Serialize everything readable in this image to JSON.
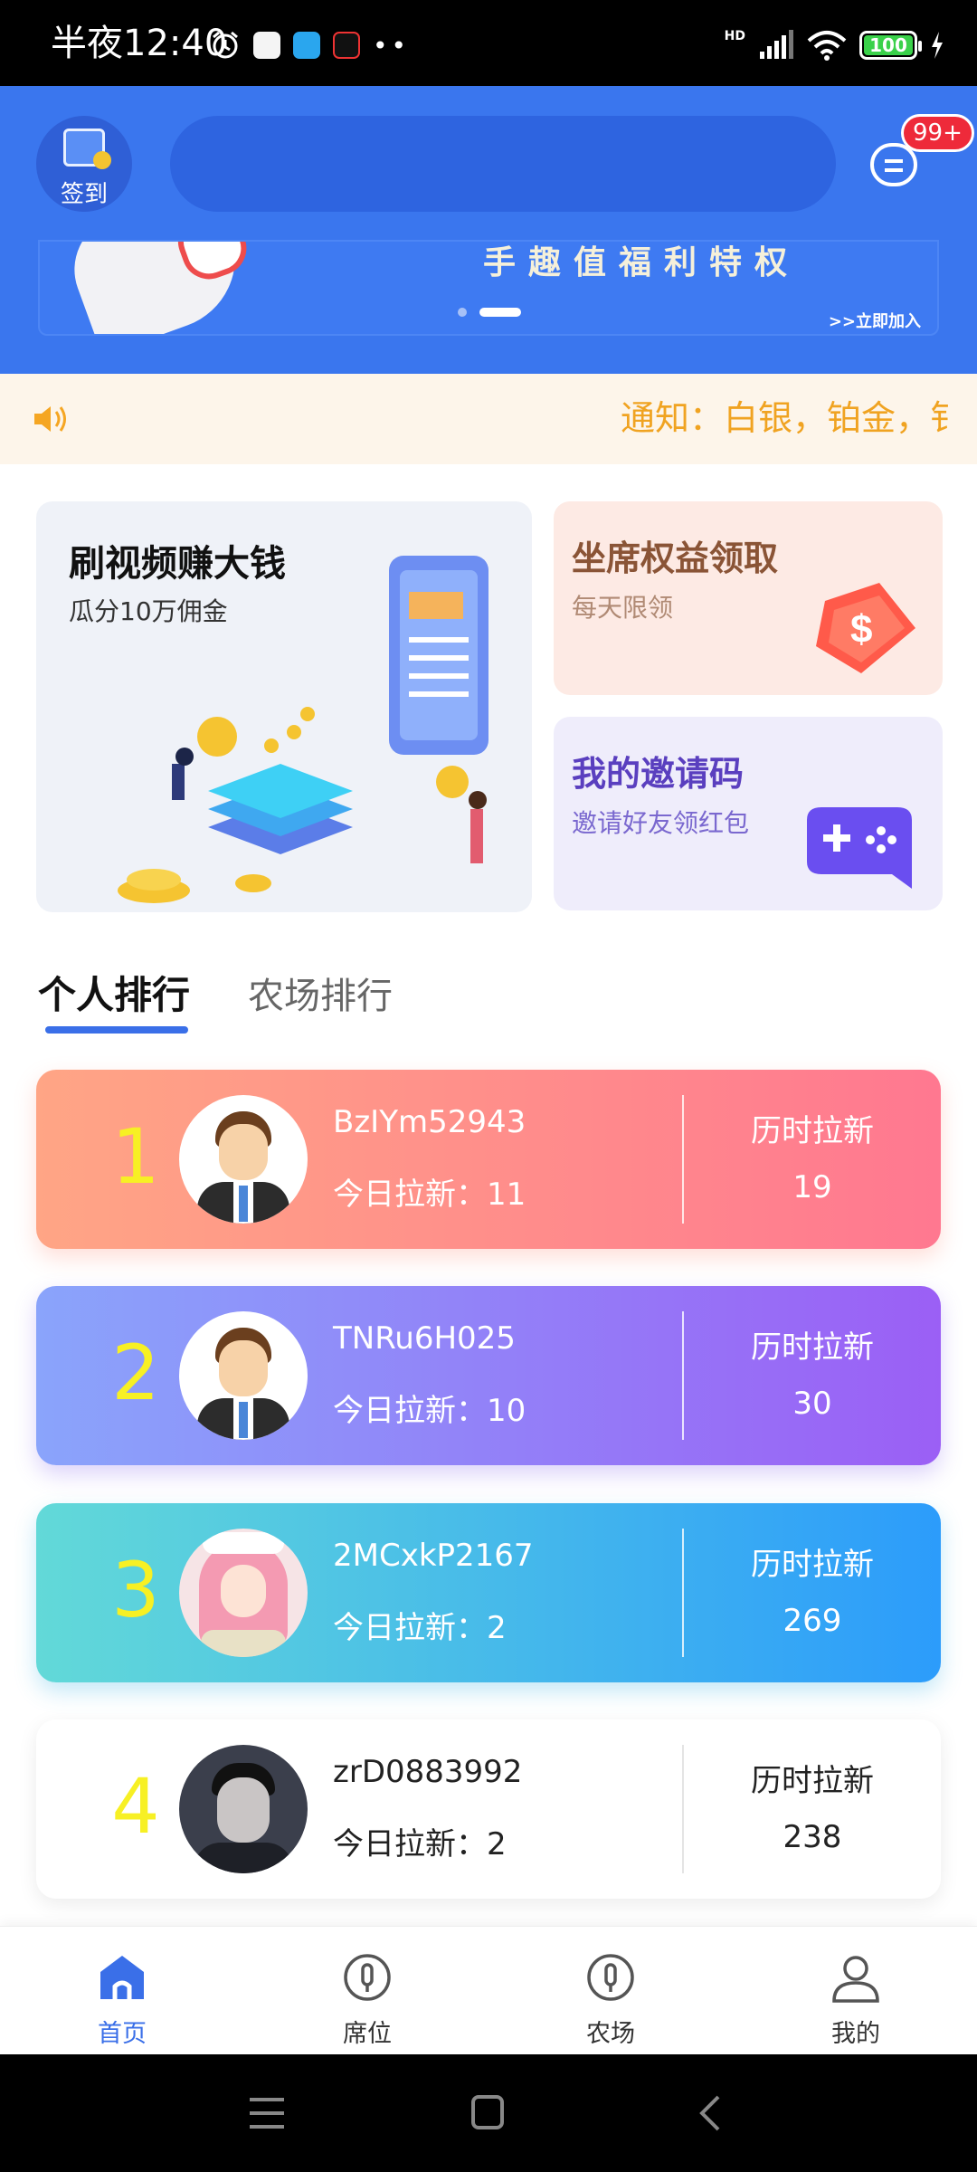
{
  "status_bar": {
    "time": "半夜12:40",
    "battery": "100",
    "network": "HD"
  },
  "header": {
    "signin_label": "签到",
    "search_placeholder": "",
    "message_badge": "99+"
  },
  "banner": {
    "partial_text": "手趣值福利特权",
    "join_label": ">>立即加入"
  },
  "notice": {
    "text": "通知：白银，铂金，钅"
  },
  "promo": {
    "video": {
      "title": "刷视频赚大钱",
      "subtitle": "瓜分10万佣金"
    },
    "benefit": {
      "title": "坐席权益领取",
      "subtitle": "每天限领"
    },
    "invite": {
      "title": "我的邀请码",
      "subtitle": "邀请好友领红包"
    }
  },
  "tabs": [
    {
      "label": "个人排行",
      "active": true
    },
    {
      "label": "农场排行",
      "active": false
    }
  ],
  "ranking": [
    {
      "rank": "1",
      "name": "BzIYm52943",
      "today": "今日拉新：11",
      "history_label": "历时拉新",
      "history_value": "19"
    },
    {
      "rank": "2",
      "name": "TNRu6H025",
      "today": "今日拉新：10",
      "history_label": "历时拉新",
      "history_value": "30"
    },
    {
      "rank": "3",
      "name": "2MCxkP2167",
      "today": "今日拉新：2",
      "history_label": "历时拉新",
      "history_value": "269"
    },
    {
      "rank": "4",
      "name": "zrD0883992",
      "today": "今日拉新：2",
      "history_label": "历时拉新",
      "history_value": "238"
    }
  ],
  "bottom_nav": [
    {
      "label": "首页",
      "icon": "home-icon",
      "active": true
    },
    {
      "label": "席位",
      "icon": "seat-icon",
      "active": false
    },
    {
      "label": "农场",
      "icon": "farm-icon",
      "active": false
    },
    {
      "label": "我的",
      "icon": "user-icon",
      "active": false
    }
  ],
  "colors": {
    "primary": "#3a76ee",
    "notice_text": "#f0a321",
    "rank_number": "#f7f024"
  }
}
